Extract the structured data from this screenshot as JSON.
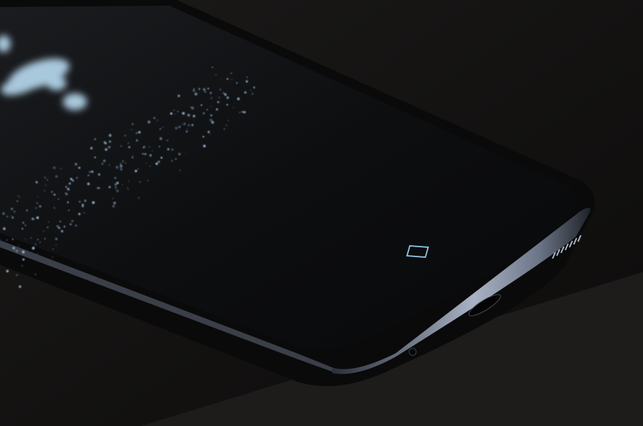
{
  "scene": {
    "subject": "smartphone",
    "colors": {
      "background": "#141312",
      "table": "#1a1918",
      "screen": "#0b0b0c",
      "frame": "#8a95a8",
      "glow": "#9cc4e0"
    },
    "icons": [
      "home-button-icon",
      "speaker-grille-icon",
      "usb-port-icon"
    ],
    "particle_count": 260
  }
}
